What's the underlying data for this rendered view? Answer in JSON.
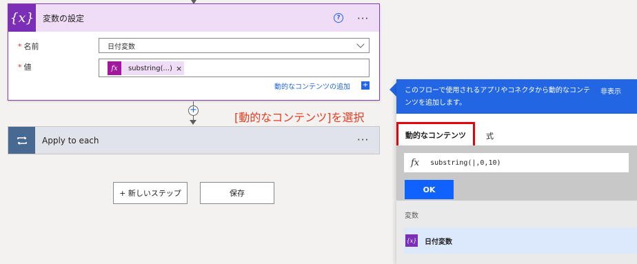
{
  "variable_card": {
    "title": "変数の設定",
    "icon": "{x}",
    "help_icon": "?",
    "more_icon": "···",
    "name_label": "名前",
    "name_value": "日付変数",
    "value_label": "値",
    "token_icon": "fx",
    "token_text": "substring(...)",
    "token_remove": "×",
    "add_dynamic_link": "動的なコンテンツの追加",
    "add_dynamic_plus": "+",
    "required_mark": "*"
  },
  "connector": {
    "plus": "+"
  },
  "annotation": "[動的なコンテンツ]を選択",
  "apply_card": {
    "title": "Apply to each",
    "more_icon": "···"
  },
  "buttons": {
    "new_step": "+ 新しいステップ",
    "save": "保存"
  },
  "panel": {
    "description": "このフローで使用されるアプリやコネクタから動的なコンテンツを追加します。",
    "hide": "非表示",
    "tab_dynamic": "動的なコンテンツ",
    "tab_expression": "式",
    "fx": "fx",
    "expression": "substring(|,0,10)",
    "ok": "OK",
    "vars_label": "変数",
    "var_item_icon": "{x}",
    "var_item": "日付変数"
  },
  "colors": {
    "accent_purple": "#7b2fb7",
    "accent_blue": "#2266e3",
    "annotation_red": "#e83a1f"
  }
}
